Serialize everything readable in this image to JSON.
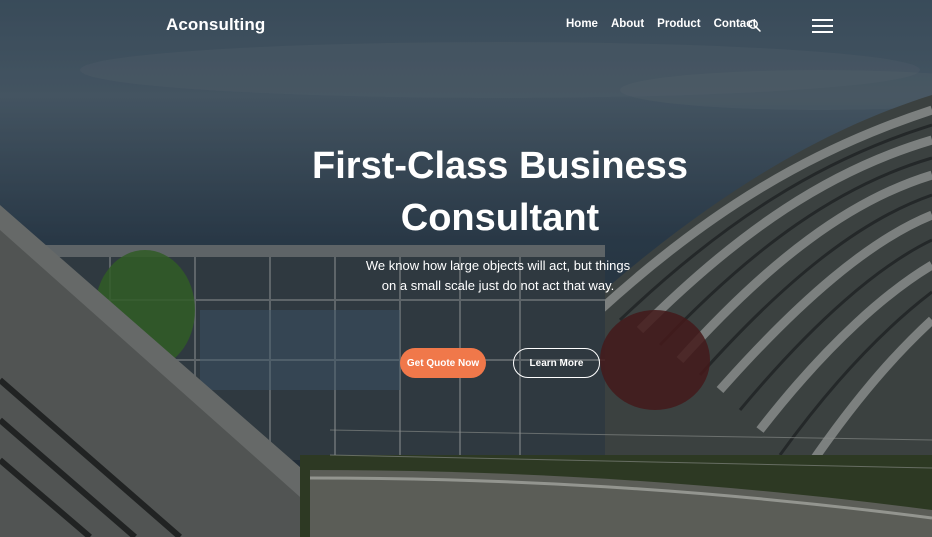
{
  "header": {
    "brand": "Aconsulting",
    "nav": [
      {
        "label": "Home"
      },
      {
        "label": "About"
      },
      {
        "label": "Product"
      },
      {
        "label": "Contact"
      }
    ],
    "search_icon": "search-icon",
    "menu_icon": "hamburger-menu-icon"
  },
  "hero": {
    "title_line1": "First-Class Business",
    "title_line2": "Consultant",
    "subtitle": "We know how large objects will act, but things on a small scale just do not act that way.",
    "primary_button": "Get Quote Now",
    "secondary_button": "Learn More"
  },
  "colors": {
    "accent": "#f0784a",
    "text": "#ffffff"
  }
}
